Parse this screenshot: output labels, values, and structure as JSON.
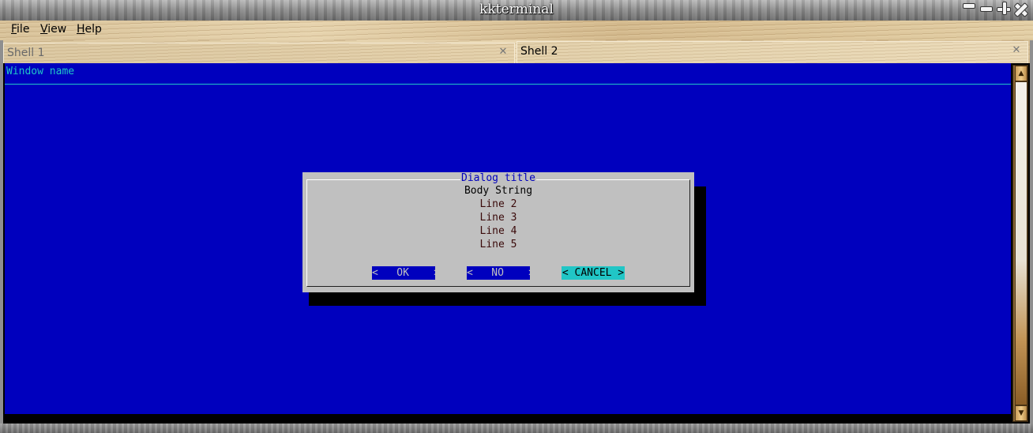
{
  "window": {
    "title": "kkterminal"
  },
  "menubar": {
    "items": [
      {
        "label": "File",
        "mnemonic": "F",
        "rest": "ile"
      },
      {
        "label": "View",
        "mnemonic": "V",
        "rest": "iew"
      },
      {
        "label": "Help",
        "mnemonic": "H",
        "rest": "elp"
      }
    ]
  },
  "tabs": [
    {
      "label": "Shell 1",
      "active": false
    },
    {
      "label": "Shell 2",
      "active": true
    }
  ],
  "terminal": {
    "window_name": "Window name",
    "background_color": "#0000be",
    "accent_color": "#21c6c6"
  },
  "dialog": {
    "title": "Dialog title",
    "body": "Body String",
    "lines": [
      "Line 2",
      "Line 3",
      "Line 4",
      "Line 5"
    ],
    "buttons": {
      "ok": "<   OK    >",
      "no": "<   NO    >",
      "cancel": "< CANCEL >"
    },
    "focused_button": "CANCEL"
  },
  "icons": {
    "window_controls": [
      "minimize-icon",
      "shade-icon",
      "maximize-icon",
      "close-icon"
    ],
    "tab_close": "close-icon",
    "scroll_up": "arrow-up-icon",
    "scroll_down": "arrow-down-icon"
  }
}
